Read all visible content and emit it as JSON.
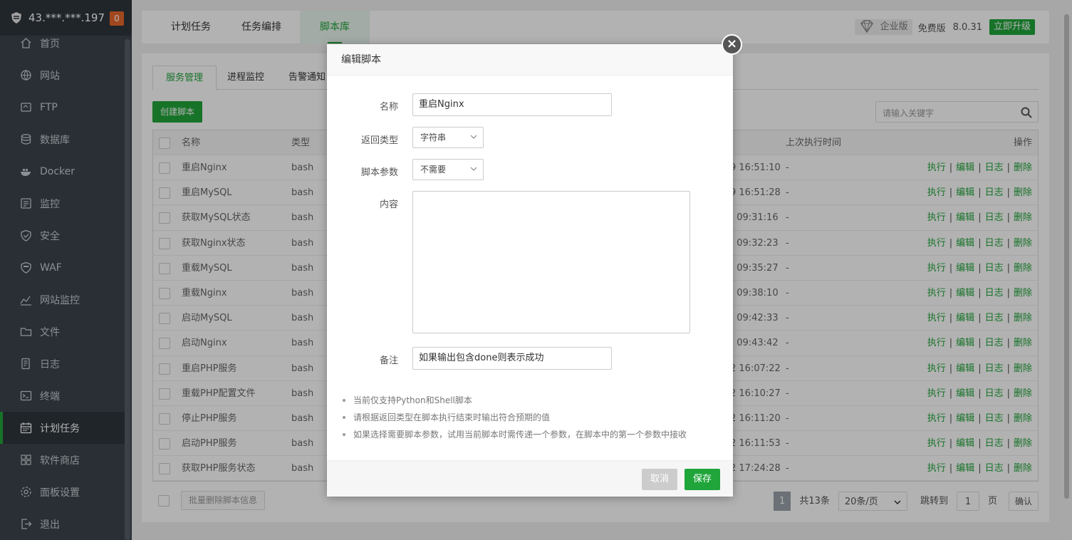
{
  "sidebar": {
    "ip": "43.***.***.197",
    "badge": "0",
    "items": [
      {
        "label": "首页",
        "icon": "home-icon"
      },
      {
        "label": "网站",
        "icon": "globe-icon"
      },
      {
        "label": "FTP",
        "icon": "ftp-icon"
      },
      {
        "label": "数据库",
        "icon": "database-icon"
      },
      {
        "label": "Docker",
        "icon": "docker-icon"
      },
      {
        "label": "监控",
        "icon": "monitor-icon"
      },
      {
        "label": "安全",
        "icon": "shield-icon"
      },
      {
        "label": "WAF",
        "icon": "waf-icon"
      },
      {
        "label": "网站监控",
        "icon": "chart-icon"
      },
      {
        "label": "文件",
        "icon": "folder-icon"
      },
      {
        "label": "日志",
        "icon": "log-icon"
      },
      {
        "label": "终端",
        "icon": "terminal-icon"
      },
      {
        "label": "计划任务",
        "icon": "calendar-icon"
      },
      {
        "label": "软件商店",
        "icon": "apps-icon"
      },
      {
        "label": "面板设置",
        "icon": "gear-icon"
      },
      {
        "label": "退出",
        "icon": "logout-icon"
      }
    ],
    "active_index": 12
  },
  "topbar": {
    "tabs": [
      "计划任务",
      "任务编排",
      "脚本库"
    ],
    "active_tab": 2,
    "edition": "企业版",
    "free": "免费版",
    "version": "8.0.31",
    "upgrade": "立即升级"
  },
  "subtabs": [
    "服务管理",
    "进程监控",
    "告警通知"
  ],
  "toolbar": {
    "create": "创建脚本",
    "search_placeholder": "请输入关键字"
  },
  "table": {
    "headers": {
      "name": "名称",
      "type": "类型",
      "last": "上次执行时间",
      "op": "操作"
    },
    "rows": [
      {
        "name": "重启Nginx",
        "type": "bash",
        "time": "9 16:51:10",
        "last": "-"
      },
      {
        "name": "重启MySQL",
        "type": "bash",
        "time": "9 16:51:28",
        "last": "-"
      },
      {
        "name": "获取MySQL状态",
        "type": "bash",
        "time": ") 09:31:16",
        "last": "-"
      },
      {
        "name": "获取Nginx状态",
        "type": "bash",
        "time": ") 09:32:23",
        "last": "-"
      },
      {
        "name": "重载MySQL",
        "type": "bash",
        "time": ") 09:35:27",
        "last": "-"
      },
      {
        "name": "重载Nginx",
        "type": "bash",
        "time": ") 09:38:10",
        "last": "-"
      },
      {
        "name": "启动MySQL",
        "type": "bash",
        "time": ") 09:42:33",
        "last": "-"
      },
      {
        "name": "启动Nginx",
        "type": "bash",
        "time": ") 09:43:42",
        "last": "-"
      },
      {
        "name": "重启PHP服务",
        "type": "bash",
        "time": "2 16:07:22",
        "last": "-"
      },
      {
        "name": "重载PHP配置文件",
        "type": "bash",
        "time": "2 16:10:27",
        "last": "-"
      },
      {
        "name": "停止PHP服务",
        "type": "bash",
        "time": "2 16:11:20",
        "last": "-"
      },
      {
        "name": "启动PHP服务",
        "type": "bash",
        "time": "2 16:11:53",
        "last": "-"
      },
      {
        "name": "获取PHP服务状态",
        "type": "bash",
        "time": "2 17:24:28",
        "last": "-"
      }
    ],
    "ops": {
      "run": "执行",
      "edit": "编辑",
      "log": "日志",
      "del": "删除",
      "sep": "|"
    }
  },
  "footer": {
    "bulk": "批量删除脚本信息",
    "page": "1",
    "total": "共13条",
    "per_page": "20条/页",
    "jump": "跳转到",
    "jump_val": "1",
    "page_unit": "页",
    "confirm": "确认"
  },
  "modal": {
    "title": "编辑脚本",
    "close": "×",
    "name_label": "名称",
    "name_value": "重启Nginx",
    "return_label": "返回类型",
    "return_value": "字符串",
    "param_label": "脚本参数",
    "param_value": "不需要",
    "content_label": "内容",
    "remark_label": "备注",
    "remark_value": "如果输出包含done则表示成功",
    "tips": [
      "当前仅支持Python和Shell脚本",
      "请根据返回类型在脚本执行结束时输出符合预期的值",
      "如果选择需要脚本参数，试用当前脚本时需传递一个参数，在脚本中的第一个参数中接收"
    ],
    "cancel": "取消",
    "save": "保存"
  }
}
